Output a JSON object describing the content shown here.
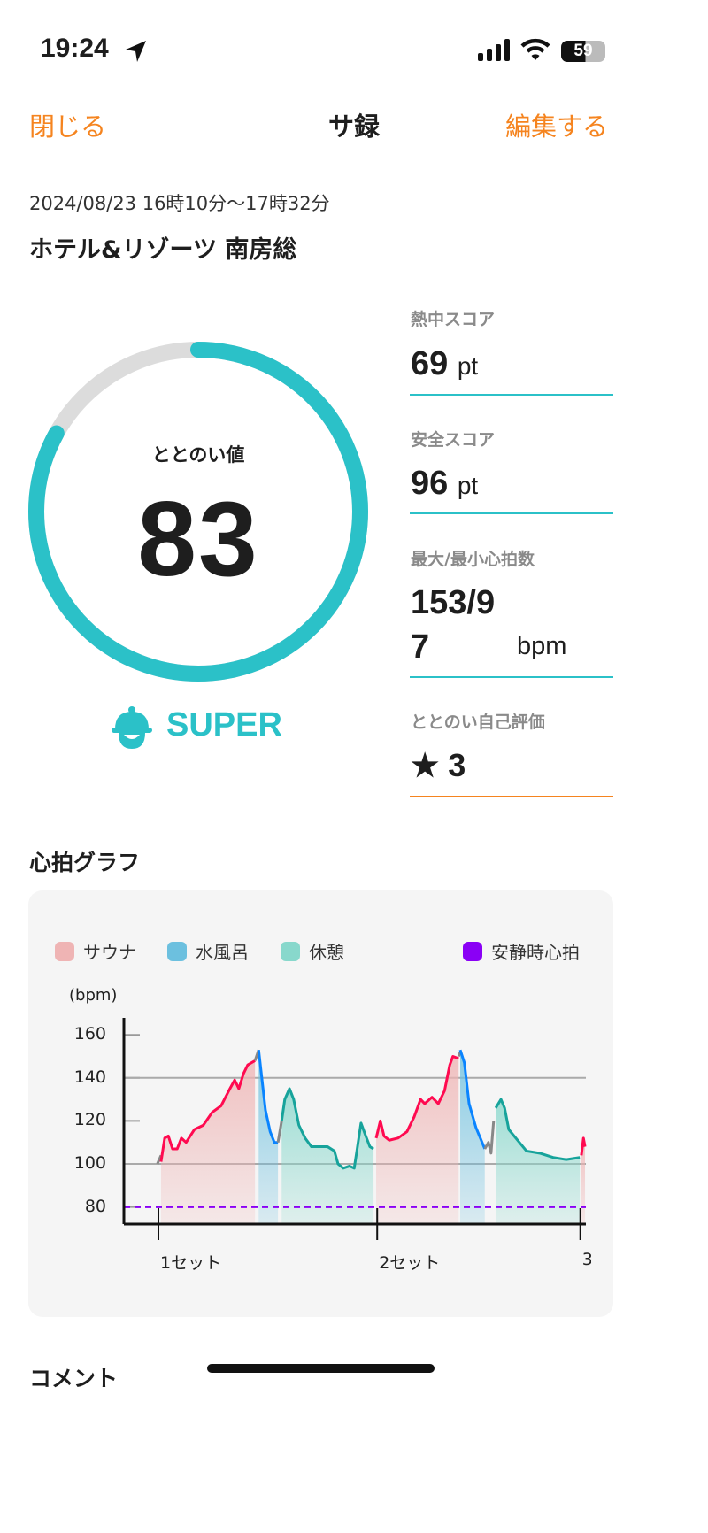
{
  "status_bar": {
    "time": "19:24",
    "battery": "59"
  },
  "nav": {
    "close": "閉じる",
    "title": "サ録",
    "edit": "編集する"
  },
  "session": {
    "datetime": "2024/08/23 16時10分〜17時32分",
    "facility": "ホテル&リゾーツ 南房総"
  },
  "gauge": {
    "label": "ととのい値",
    "value": "83",
    "fraction": 0.83,
    "rank": "SUPER",
    "color": "#2bc1c8",
    "track_color": "#dcdcdc"
  },
  "stats": [
    {
      "label": "熱中スコア",
      "value": "69",
      "unit": "pt"
    },
    {
      "label": "安全スコア",
      "value": "96",
      "unit": "pt"
    },
    {
      "label": "最大/最小心拍数",
      "value_line1": "153/9",
      "value_line2": "7",
      "unit": "bpm"
    },
    {
      "label": "ととのい自己評価",
      "star": "★",
      "value": "3"
    }
  ],
  "accent": "#f5841f",
  "heart_section": {
    "title": "心拍グラフ"
  },
  "comment_section": {
    "title": "コメント"
  },
  "chart_data": {
    "type": "line",
    "ylabel": "(bpm)",
    "ylim": [
      72,
      165
    ],
    "yticks": [
      "160",
      "140",
      "120",
      "100",
      "80"
    ],
    "ytick_values": [
      160,
      140,
      120,
      100,
      80
    ],
    "gridlines": [
      140,
      100
    ],
    "xticks": [
      {
        "label": "1セット",
        "t": 0
      },
      {
        "label": "2セット",
        "t": 41.9
      },
      {
        "label": "3",
        "t": 80.8
      }
    ],
    "legend": [
      {
        "name": "サウナ",
        "color": "#efb4b4"
      },
      {
        "name": "水風呂",
        "color": "#6cc0df"
      },
      {
        "name": "休憩",
        "color": "#88d8cc"
      },
      {
        "name": "安静時心拍",
        "color": "#8a00f5"
      }
    ],
    "resting_hr": 80,
    "segments": [
      {
        "phase": "transition",
        "points": [
          [
            -0.2,
            100
          ],
          [
            0.5,
            104
          ]
        ]
      },
      {
        "phase": "sauna",
        "points": [
          [
            0.5,
            101
          ],
          [
            1.2,
            112
          ],
          [
            1.9,
            113
          ],
          [
            2.7,
            107
          ],
          [
            3.6,
            107
          ],
          [
            4.4,
            112
          ],
          [
            5.3,
            110
          ],
          [
            6.9,
            116
          ],
          [
            8.6,
            118
          ],
          [
            10.3,
            124
          ],
          [
            12,
            127
          ],
          [
            13.7,
            135
          ],
          [
            14.6,
            139
          ],
          [
            15.4,
            135
          ],
          [
            16.3,
            142
          ],
          [
            17.1,
            146
          ],
          [
            18.5,
            148
          ]
        ]
      },
      {
        "phase": "transition",
        "points": [
          [
            18.5,
            148
          ],
          [
            19.2,
            153
          ]
        ]
      },
      {
        "phase": "water",
        "points": [
          [
            19.2,
            153
          ],
          [
            19.8,
            140
          ],
          [
            20.5,
            125
          ],
          [
            21.4,
            115
          ],
          [
            22.2,
            110
          ],
          [
            22.9,
            110
          ]
        ]
      },
      {
        "phase": "transition",
        "points": [
          [
            22.9,
            110
          ],
          [
            23.6,
            120
          ]
        ]
      },
      {
        "phase": "rest",
        "points": [
          [
            23.6,
            120
          ],
          [
            24.2,
            130
          ],
          [
            25.1,
            135
          ],
          [
            25.9,
            130
          ],
          [
            26.9,
            118
          ],
          [
            28.1,
            112
          ],
          [
            29.3,
            108
          ],
          [
            30.7,
            108
          ],
          [
            32.4,
            108
          ],
          [
            33.7,
            106
          ],
          [
            34.4,
            100
          ],
          [
            35.4,
            98
          ],
          [
            36.6,
            99
          ],
          [
            37.5,
            98
          ],
          [
            38,
            106
          ],
          [
            38.8,
            119
          ],
          [
            39.7,
            113
          ],
          [
            40.5,
            108
          ],
          [
            41.2,
            107
          ]
        ]
      },
      {
        "phase": "sauna",
        "points": [
          [
            41.7,
            112
          ],
          [
            42.5,
            120
          ],
          [
            43.2,
            113
          ],
          [
            44.2,
            111
          ],
          [
            45.9,
            112
          ],
          [
            47.6,
            115
          ],
          [
            49,
            122
          ],
          [
            50.2,
            130
          ],
          [
            51,
            128
          ],
          [
            52.4,
            131
          ],
          [
            53.6,
            128
          ],
          [
            54.8,
            134
          ],
          [
            55.8,
            146
          ],
          [
            56.4,
            150
          ],
          [
            57.5,
            149
          ]
        ]
      },
      {
        "phase": "transition",
        "points": [
          [
            57.5,
            150
          ],
          [
            57.8,
            152
          ]
        ]
      },
      {
        "phase": "water",
        "points": [
          [
            57.8,
            153
          ],
          [
            58.6,
            147
          ],
          [
            59.5,
            128
          ],
          [
            60.8,
            117
          ],
          [
            62.5,
            107
          ]
        ]
      },
      {
        "phase": "transition",
        "points": [
          [
            62.5,
            107
          ],
          [
            63.2,
            110
          ],
          [
            63.7,
            105
          ],
          [
            64.2,
            120
          ]
        ]
      },
      {
        "phase": "rest",
        "points": [
          [
            64.6,
            126
          ],
          [
            65.6,
            130
          ],
          [
            66.3,
            126
          ],
          [
            67.1,
            116
          ],
          [
            68.8,
            111
          ],
          [
            70.5,
            106
          ],
          [
            73,
            105
          ],
          [
            75.6,
            103
          ],
          [
            78.1,
            102
          ],
          [
            80.7,
            103
          ]
        ]
      },
      {
        "phase": "sauna",
        "points": [
          [
            81,
            104
          ],
          [
            81.4,
            112
          ],
          [
            81.7,
            108
          ]
        ]
      }
    ]
  }
}
